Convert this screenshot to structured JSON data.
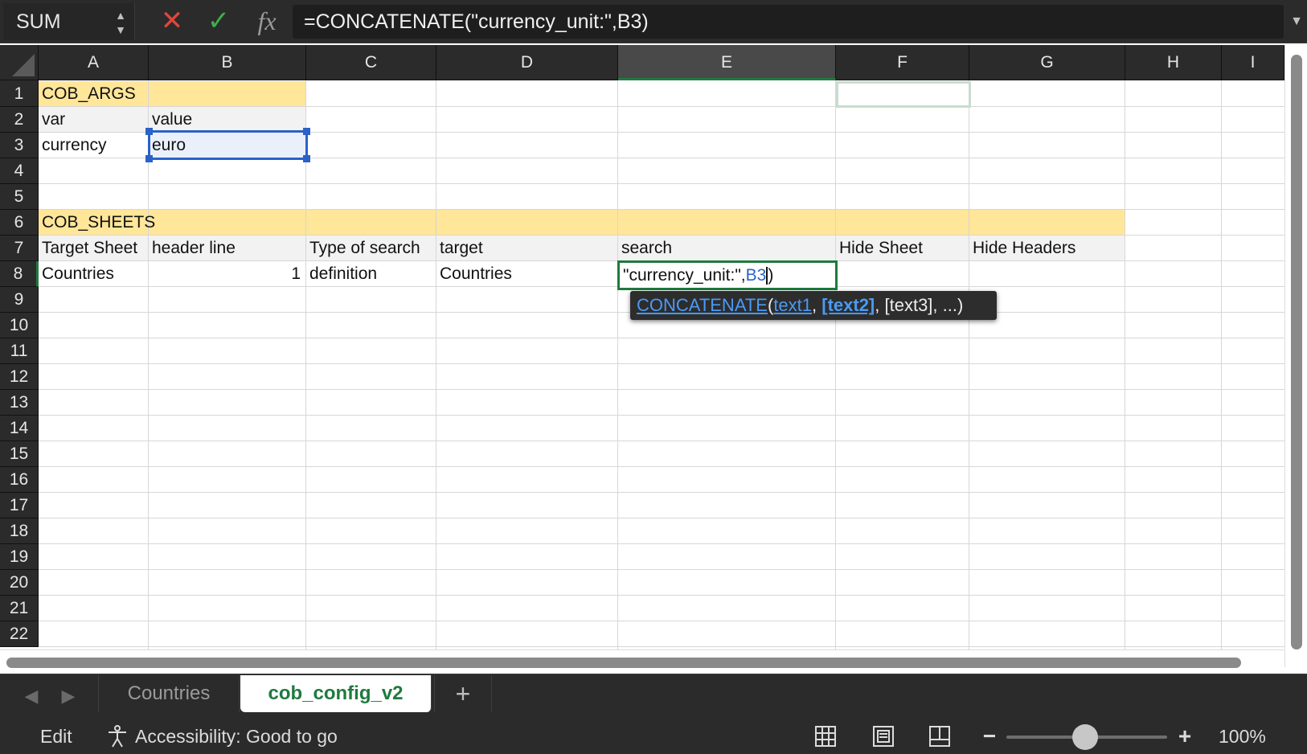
{
  "formula_bar": {
    "name_box": "SUM",
    "cancel_icon": "✕",
    "enter_icon": "✓",
    "fx_label": "fx",
    "formula": "=CONCATENATE(\"currency_unit:\",B3)"
  },
  "columns": [
    "A",
    "B",
    "C",
    "D",
    "E",
    "F",
    "G",
    "H",
    "I"
  ],
  "selected_column": "E",
  "rows": [
    "1",
    "2",
    "3",
    "4",
    "5",
    "6",
    "7",
    "8",
    "9",
    "10",
    "11",
    "12",
    "13",
    "14",
    "15",
    "16",
    "17",
    "18",
    "19",
    "20",
    "21",
    "22"
  ],
  "colors": {
    "section_fill": "#ffe699",
    "header_fill": "#f2f2f2",
    "selection_blue": "#2a62c8",
    "active_green": "#1f7a3e"
  },
  "cells": {
    "A1": "COB_ARGS",
    "A2": "var",
    "B2": "value",
    "A3": "currency",
    "B3": "euro",
    "A6": "COB_SHEETS",
    "A7": "Target Sheet",
    "B7": "header line",
    "C7": "Type of search",
    "D7": "target",
    "E7": "search",
    "F7": "Hide Sheet",
    "G7": "Hide Headers",
    "A8": "Countries",
    "B8": "1",
    "C8": "definition",
    "D8": "Countries"
  },
  "edit_cell": {
    "address": "E8",
    "text_before_ref": "\"currency_unit:\",",
    "ref": "B3",
    "text_after_ref": ")"
  },
  "tooltip": {
    "function": "CONCATENATE",
    "open_paren": "(",
    "arg1": "text1",
    "sep1": ", ",
    "arg2": "[text2]",
    "rest": ", [text3], ...)"
  },
  "sheet_tabs": [
    {
      "label": "Countries",
      "active": false
    },
    {
      "label": "cob_config_v2",
      "active": true
    }
  ],
  "add_sheet": "+",
  "status": {
    "mode": "Edit",
    "accessibility": "Accessibility: Good to go",
    "zoom_out": "−",
    "zoom_in": "+",
    "zoom": "100%",
    "zoom_level": 1.0
  }
}
